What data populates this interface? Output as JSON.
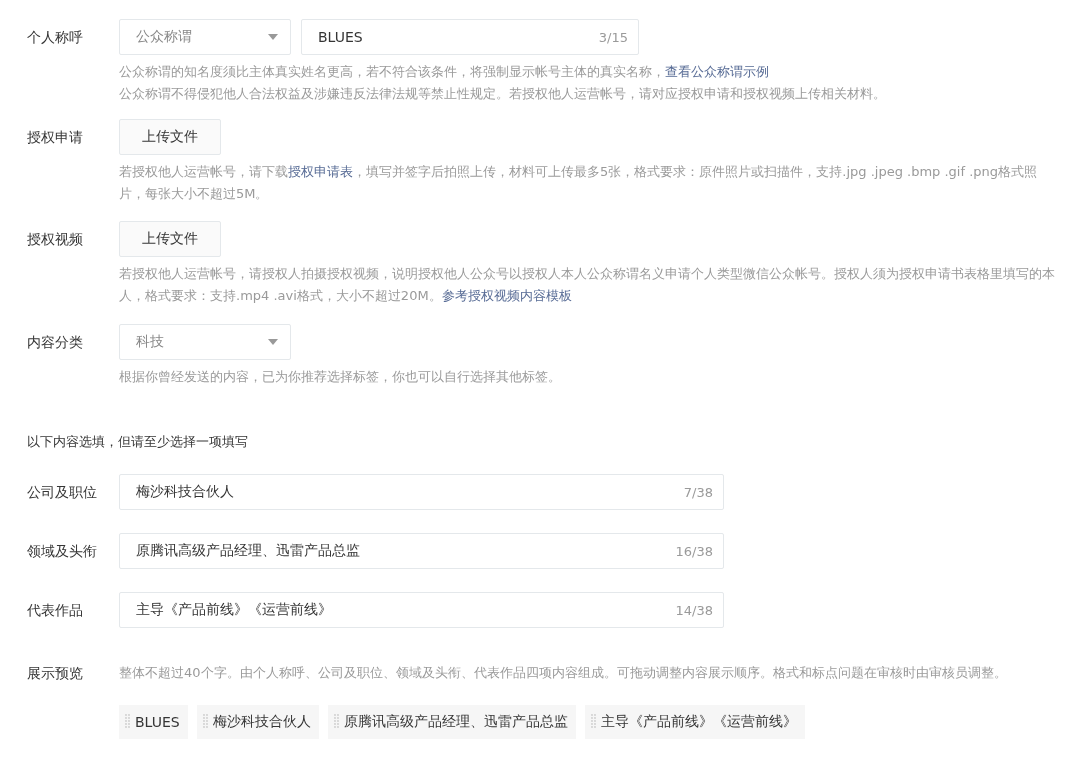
{
  "fields": [
    {
      "kind": "select_input",
      "label": "个人称呼",
      "select": {
        "value": "公众称谓"
      },
      "input": {
        "value": "BLUES",
        "counter": "3/15"
      },
      "help": [
        [
          {
            "kind": "text",
            "text": "公众称谓的知名度须比主体真实姓名更高，若不符合该条件，将强制显示帐号主体的真实名称，"
          },
          {
            "kind": "link",
            "text": "查看公众称谓示例"
          }
        ],
        [
          {
            "kind": "text",
            "text": "公众称谓不得侵犯他人合法权益及涉嫌违反法律法规等禁止性规定。若授权他人运营帐号，请对应授权申请和授权视频上传相关材料。"
          }
        ]
      ]
    },
    {
      "kind": "upload",
      "label": "授权申请",
      "button": "上传文件",
      "help": [
        [
          {
            "kind": "text",
            "text": "若授权他人运营帐号，请下载"
          },
          {
            "kind": "link",
            "text": "授权申请表"
          },
          {
            "kind": "text",
            "text": "，填写并签字后拍照上传，材料可上传最多5张，格式要求：原件照片或扫描件，支持.jpg .jpeg .bmp .gif .png格式照片，每张大小不超过5M。"
          }
        ]
      ]
    },
    {
      "kind": "upload",
      "label": "授权视频",
      "button": "上传文件",
      "help": [
        [
          {
            "kind": "text",
            "text": "若授权他人运营帐号，请授权人拍摄授权视频，说明授权他人公众号以授权人本人公众称谓名义申请个人类型微信公众帐号。授权人须为授权申请书表格里填写的本人，格式要求：支持.mp4 .avi格式，大小不超过20M。"
          },
          {
            "kind": "link",
            "text": "参考授权视频内容模板"
          }
        ]
      ]
    },
    {
      "kind": "select",
      "label": "内容分类",
      "select": {
        "value": "科技"
      },
      "help": [
        [
          {
            "kind": "text",
            "text": "根据你曾经发送的内容，已为你推荐选择标签，你也可以自行选择其他标签。"
          }
        ]
      ]
    }
  ],
  "optional_heading": "以下内容选填，但请至少选择一项填写",
  "optional_fields": [
    {
      "label": "公司及职位",
      "value": "梅沙科技合伙人",
      "counter": "7/38"
    },
    {
      "label": "领域及头衔",
      "value": "原腾讯高级产品经理、迅雷产品总监",
      "counter": "16/38"
    },
    {
      "label": "代表作品",
      "value": "主导《产品前线》《运营前线》",
      "counter": "14/38"
    }
  ],
  "preview": {
    "label": "展示预览",
    "help": "整体不超过40个字。由个人称呼、公司及职位、领域及头衔、代表作品四项内容组成。可拖动调整内容展示顺序。格式和标点问题在审核时由审核员调整。",
    "chips": [
      "BLUES",
      "梅沙科技合伙人",
      "原腾讯高级产品经理、迅雷产品总监",
      "主导《产品前线》《运营前线》"
    ]
  }
}
